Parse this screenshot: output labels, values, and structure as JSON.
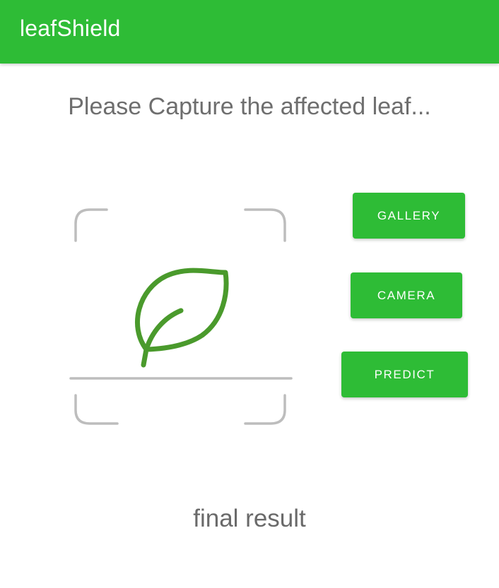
{
  "app_bar": {
    "title": "leafShield"
  },
  "main": {
    "instruction": "Please Capture the affected leaf...",
    "preview_icon": "leaf-scan-icon",
    "result_text": "final result"
  },
  "actions": {
    "gallery_label": "GALLERY",
    "camera_label": "CAMERA",
    "predict_label": "PREDICT"
  },
  "colors": {
    "primary": "#2ebc36",
    "leaf": "#4a9a2c",
    "scan_frame": "#bdbdbd",
    "text_secondary": "#6e6e6e"
  }
}
